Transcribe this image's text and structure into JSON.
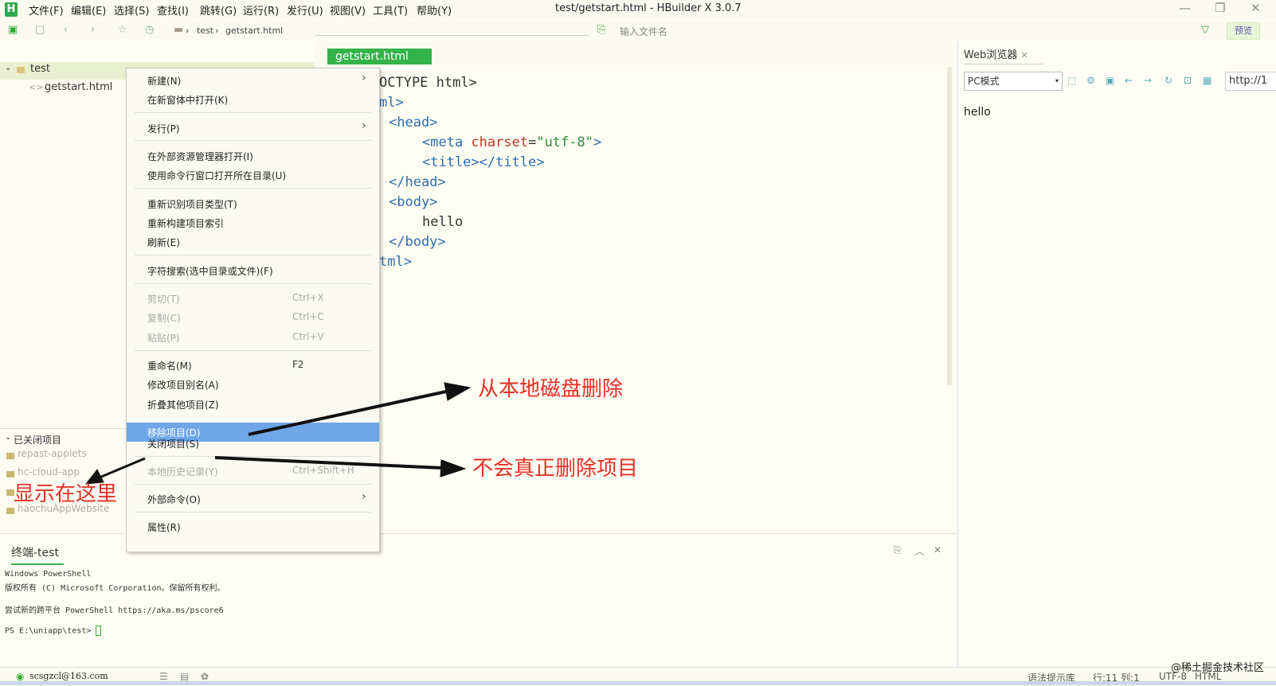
{
  "app": {
    "window_title": "test/getstart.html - HBuilder X 3.0.7",
    "menu": [
      "文件(F)",
      "编辑(E)",
      "选择(S)",
      "查找(I)",
      "跳转(G)",
      "运行(R)",
      "发行(U)",
      "视图(V)",
      "工具(T)",
      "帮助(Y)"
    ]
  },
  "toolbar": {
    "breadcrumb": [
      "test",
      "getstart.html"
    ],
    "file_search_placeholder": "输入文件名",
    "preview_label": "预览"
  },
  "sidebar": {
    "project_name": "test",
    "file_name": "getstart.html",
    "closed_header": "已关闭项目",
    "closed_projects": [
      "repast-applets",
      "hc-cloud-app",
      "",
      "haochuAppWebsite"
    ]
  },
  "context_menu": {
    "items": [
      {
        "label": "新建(N)",
        "shortcut": "",
        "submenu": true,
        "disabled": false
      },
      {
        "label": "在新窗体中打开(K)",
        "shortcut": "",
        "submenu": false,
        "disabled": false
      },
      {
        "label": "发行(P)",
        "shortcut": "",
        "submenu": true,
        "disabled": false
      },
      {
        "label": "在外部资源管理器打开(I)",
        "shortcut": "",
        "submenu": false,
        "disabled": false
      },
      {
        "label": "使用命令行窗口打开所在目录(U)",
        "shortcut": "",
        "submenu": false,
        "disabled": false
      },
      {
        "label": "重新识别项目类型(T)",
        "shortcut": "",
        "submenu": false,
        "disabled": false
      },
      {
        "label": "重新构建项目索引",
        "shortcut": "",
        "submenu": false,
        "disabled": false
      },
      {
        "label": "刷新(E)",
        "shortcut": "",
        "submenu": false,
        "disabled": false
      },
      {
        "label": "字符搜索(选中目录或文件)(F)",
        "shortcut": "",
        "submenu": false,
        "disabled": false
      },
      {
        "label": "剪切(T)",
        "shortcut": "Ctrl+X",
        "submenu": false,
        "disabled": true
      },
      {
        "label": "复制(C)",
        "shortcut": "Ctrl+C",
        "submenu": false,
        "disabled": true
      },
      {
        "label": "粘贴(P)",
        "shortcut": "Ctrl+V",
        "submenu": false,
        "disabled": true
      },
      {
        "label": "重命名(M)",
        "shortcut": "F2",
        "submenu": false,
        "disabled": false
      },
      {
        "label": "修改项目别名(A)",
        "shortcut": "",
        "submenu": false,
        "disabled": false
      },
      {
        "label": "折叠其他项目(Z)",
        "shortcut": "",
        "submenu": false,
        "disabled": false
      },
      {
        "label": "移除项目(D)",
        "shortcut": "",
        "submenu": false,
        "disabled": false,
        "highlighted": true
      },
      {
        "label": "关闭项目(S)",
        "shortcut": "",
        "submenu": false,
        "disabled": false
      },
      {
        "label": "本地历史记录(Y)",
        "shortcut": "Ctrl+Shift+H",
        "submenu": false,
        "disabled": true
      },
      {
        "label": "外部命令(O)",
        "shortcut": "",
        "submenu": true,
        "disabled": false
      },
      {
        "label": "属性(R)",
        "shortcut": "",
        "submenu": false,
        "disabled": false
      }
    ]
  },
  "editor": {
    "tab_label": "getstart.html",
    "lines": [
      "OCTYPE html>",
      "ml>",
      "<head>",
      "<meta charset=\"utf-8\">",
      "<title></title>",
      "</head>",
      "<body>",
      "hello",
      "</body>",
      "tml>"
    ]
  },
  "browser": {
    "tab_label": "Web浏览器",
    "mode": "PC模式",
    "url": "http://1",
    "content": "hello"
  },
  "console": {
    "tab_label": "终端-test",
    "lines": [
      "Windows PowerShell",
      "版权所有 (C) Microsoft Corporation。保留所有权利。",
      "",
      "尝试新的跨平台 PowerShell https://aka.ms/pscore6",
      "",
      "PS E:\\uniapp\\test> "
    ]
  },
  "annotations": {
    "delete_disk": "从本地磁盘删除",
    "not_delete": "不会真正删除项目",
    "show_here": "显示在这里"
  },
  "statusbar": {
    "user": "scsgzcl@163.com",
    "syntax": "语法提示库",
    "position": "行:11  列:1",
    "encoding": "UTF-8",
    "lang": "HTML",
    "watermark": "@稀土掘金技术社区"
  },
  "colors": {
    "accent": "#34b34a",
    "highlight": "#6fa6e8",
    "annotation": "#e5302a"
  }
}
